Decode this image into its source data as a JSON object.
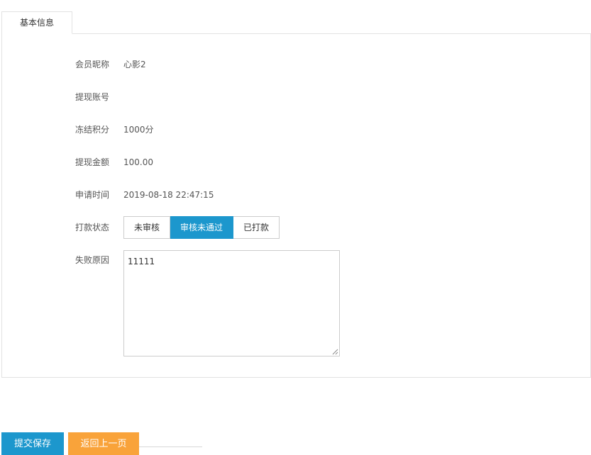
{
  "tabs": [
    {
      "label": "基本信息",
      "active": true
    }
  ],
  "form": {
    "nickname": {
      "label": "会员昵称",
      "value": "心影2"
    },
    "account": {
      "label": "提现账号",
      "value": ""
    },
    "frozen_points": {
      "label": "冻结积分",
      "value": "1000分"
    },
    "amount": {
      "label": "提现金额",
      "value": "100.00"
    },
    "apply_time": {
      "label": "申请时间",
      "value": "2019-08-18 22:47:15"
    },
    "payment_status": {
      "label": "打款状态",
      "options": [
        "未审核",
        "审核未通过",
        "已打款"
      ],
      "selected": "审核未通过"
    },
    "fail_reason": {
      "label": "失败原因",
      "value": "11111"
    }
  },
  "actions": {
    "submit_label": "提交保存",
    "back_label": "返回上一页"
  },
  "colors": {
    "primary": "#1c97cd",
    "warning": "#f9a33a",
    "border": "#e2e2e2"
  }
}
